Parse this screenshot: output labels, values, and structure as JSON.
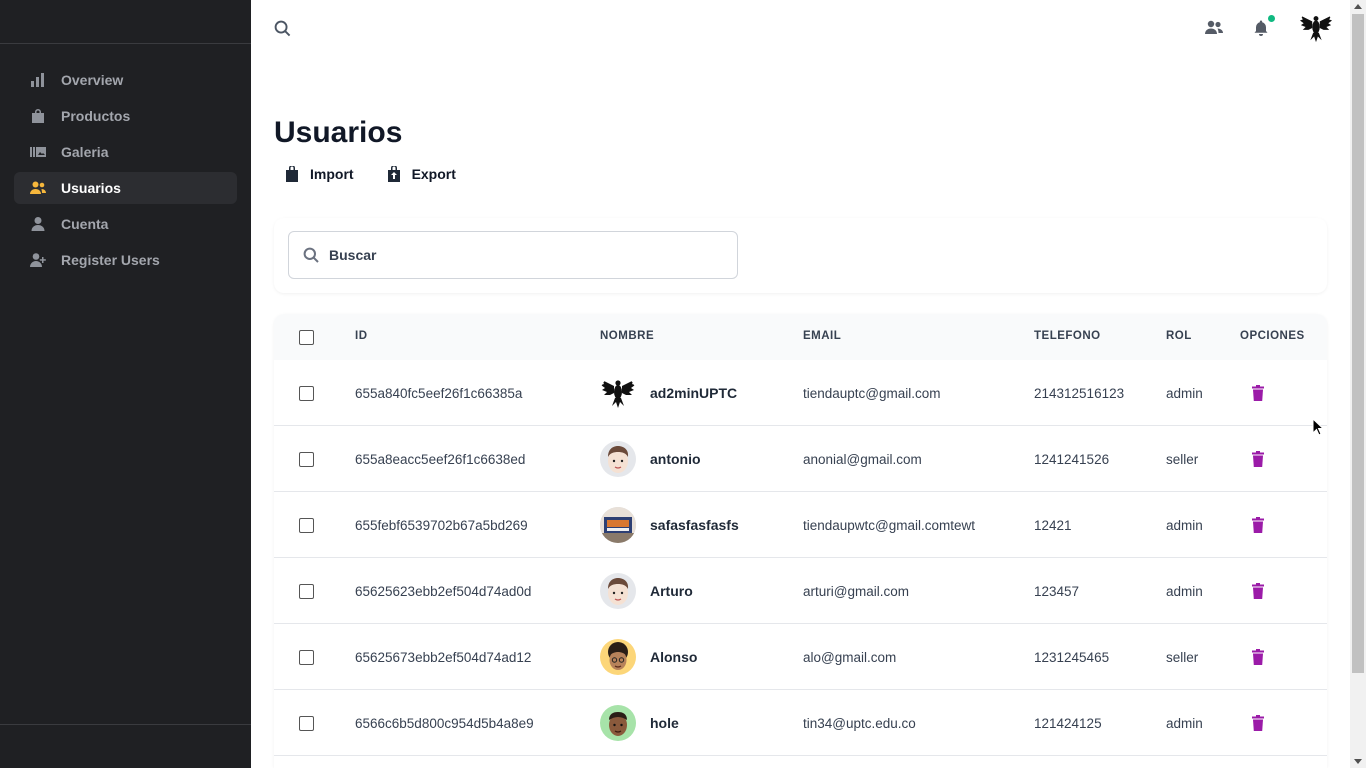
{
  "sidebar": {
    "items": [
      {
        "label": "Overview",
        "icon": "bar-chart-icon",
        "active": false
      },
      {
        "label": "Productos",
        "icon": "shopping-bag-icon",
        "active": false
      },
      {
        "label": "Galeria",
        "icon": "gallery-icon",
        "active": false
      },
      {
        "label": "Usuarios",
        "icon": "users-icon",
        "active": true
      },
      {
        "label": "Cuenta",
        "icon": "user-icon",
        "active": false
      },
      {
        "label": "Register Users",
        "icon": "user-plus-icon",
        "active": false
      }
    ]
  },
  "topbar": {
    "icons": [
      "search-icon",
      "users-icon",
      "bell-icon",
      "avatar"
    ],
    "notification_dot_color": "#10b981"
  },
  "page": {
    "title": "Usuarios",
    "import_label": "Import",
    "export_label": "Export"
  },
  "search": {
    "placeholder": "Buscar"
  },
  "table": {
    "headers": [
      "ID",
      "NOMBRE",
      "EMAIL",
      "TELEFONO",
      "ROL",
      "OPCIONES"
    ],
    "rows": [
      {
        "id": "655a840fc5eef26f1c66385a",
        "name": "ad2minUPTC",
        "email": "tiendauptc@gmail.com",
        "tel": "214312516123",
        "rol": "admin",
        "avatar": "eagle-crest"
      },
      {
        "id": "655a8eacc5eef26f1c6638ed",
        "name": "antonio",
        "email": "anonial@gmail.com",
        "tel": "1241241526",
        "rol": "seller",
        "avatar": "face-light"
      },
      {
        "id": "655febf6539702b67a5bd269",
        "name": "safasfasfasfs",
        "email": "tiendaupwtc@gmail.comtewt",
        "tel": "12421",
        "rol": "admin",
        "avatar": "photo"
      },
      {
        "id": "65625623ebb2ef504d74ad0d",
        "name": "Arturo",
        "email": "arturi@gmail.com",
        "tel": "123457",
        "rol": "admin",
        "avatar": "face-light"
      },
      {
        "id": "65625673ebb2ef504d74ad12",
        "name": "Alonso",
        "email": "alo@gmail.com",
        "tel": "1231245465",
        "rol": "seller",
        "avatar": "face-curly"
      },
      {
        "id": "6566c6b5d800c954d5b4a8e9",
        "name": "hole",
        "email": "tin34@uptc.edu.co",
        "tel": "121424125",
        "rol": "admin",
        "avatar": "face-dark"
      }
    ]
  },
  "colors": {
    "sidebar_bg": "#1f2023",
    "active_icon": "#f6b73c",
    "trash": "#9b1ba8"
  }
}
